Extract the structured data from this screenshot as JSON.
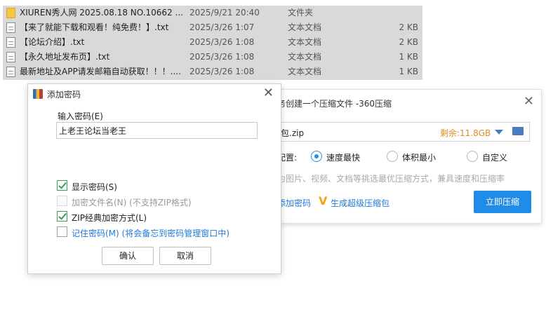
{
  "file_list": {
    "rows": [
      {
        "icon": "folder-icon",
        "name": "XIUREN秀人网 2025.08.18 NO.10662 ...",
        "date": "2025/9/21 20:40",
        "type": "文件夹",
        "size": ""
      },
      {
        "icon": "text-file-icon",
        "name": "【来了就能下载和观看！纯免费！】.txt",
        "date": "2025/3/26 1:07",
        "type": "文本文档",
        "size": "2 KB"
      },
      {
        "icon": "text-file-icon",
        "name": "【论坛介绍】.txt",
        "date": "2025/3/26 1:08",
        "type": "文本文档",
        "size": "2 KB"
      },
      {
        "icon": "text-file-icon",
        "name": "【永久地址发布页】.txt",
        "date": "2025/3/26 1:08",
        "type": "文本文档",
        "size": "1 KB"
      },
      {
        "icon": "text-file-icon",
        "name": "最新地址及APP请发邮箱自动获取！！！....",
        "date": "2025/3/26 1:08",
        "type": "文本文档",
        "size": "1 KB"
      }
    ]
  },
  "compress_dialog": {
    "title": "务创建一个压缩文件 -360压缩",
    "path_name": "包.zip",
    "free_space": "剩余:11.8GB",
    "config_label": "配置:",
    "options": [
      "速度最快",
      "体积最小",
      "自定义"
    ],
    "selected_option": "速度最快",
    "hint": "为图片、视频、文档等挑选最优压缩方式，兼具速度和压缩率",
    "add_password_link": "添加密码",
    "super_link": "生成超级压缩包",
    "compress_button": "立即压缩",
    "colors": {
      "accent": "#1f8ce8",
      "free_space": "#e28b1f"
    }
  },
  "password_dialog": {
    "title": "添加密码",
    "input_label": "输入密码(E)",
    "password_value": "上老王论坛当老王",
    "checkboxes": {
      "show_password": "显示密码(S)",
      "encrypt_names": "加密文件名(N) (不支持ZIP格式)",
      "zip_classic": "ZIP经典加密方式(L)",
      "remember": "记住密码(M) (将会备忘到密码管理窗口中)"
    },
    "ok_button": "确认",
    "cancel_button": "取消"
  }
}
